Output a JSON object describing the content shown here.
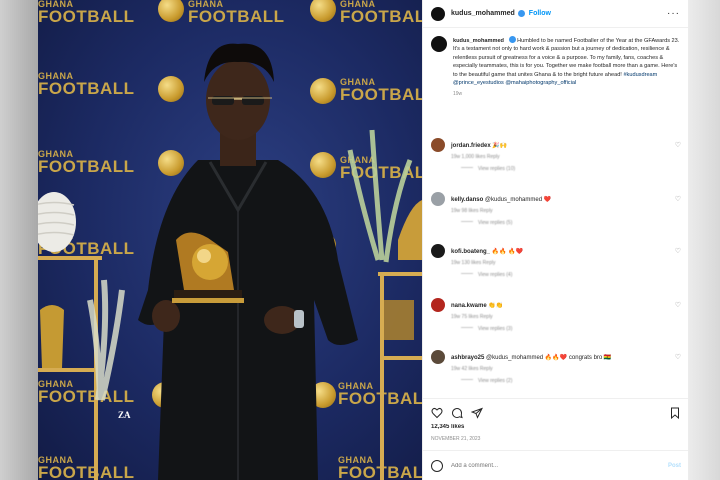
{
  "photo": {
    "logo_line1": "GHANA",
    "logo_line2": "FOOTBALL",
    "watermark": "ZA"
  },
  "post": {
    "username": "kudus_mohammed",
    "follow_label": "Follow",
    "more_label": "···",
    "caption": {
      "username": "kudus_mohammed",
      "text": "Humbled to be named Footballer of the Year at the GFAwards 23. It's a testament not only to hard work & passion but a journey of dedication, resilience & relentless pursuit of greatness for a voice & a purpose. To my family, fans, coaches & especially teammates, this is for you. Together we make football more than a game. Here's to the beautiful game that unites Ghana & to the bright future ahead!",
      "hashtag": "#kudusdream",
      "mentions": "@prince_eyestudios @mahaiphotography_official",
      "time": "19w"
    },
    "comments": [
      {
        "user": "jordan.friedex",
        "text": "🎉🙌",
        "meta": "19w  1,000 likes  Reply",
        "replies": "View replies (10)",
        "avatar_color": "#8a4b2a"
      },
      {
        "user": "kelly.danso",
        "text": "@kudus_mohammed ❤️",
        "meta": "19w  98 likes  Reply",
        "replies": "View replies (5)",
        "avatar_color": "#9aa0a6"
      },
      {
        "user": "kofi.boateng_",
        "text": "🔥🔥 🔥❤️",
        "meta": "19w  130 likes  Reply",
        "replies": "View replies (4)",
        "avatar_color": "#1a1a1a"
      },
      {
        "user": "nana.kwame",
        "text": "👏👏",
        "meta": "19w  75 likes  Reply",
        "replies": "View replies (3)",
        "avatar_color": "#b3261e"
      },
      {
        "user": "ashbrayo25",
        "text": "@kudus_mohammed 🔥🔥❤️ congrats bro 🇬🇭",
        "meta": "19w  42 likes  Reply",
        "replies": "View replies (2)",
        "avatar_color": "#5b4a3a"
      }
    ],
    "likes": "12,345 likes",
    "post_time": "NOVEMBER 21, 2023",
    "add_comment_placeholder": "Add a comment...",
    "post_button": "Post"
  },
  "icons": {
    "heart": "heart-icon",
    "comment": "comment-icon",
    "share": "share-icon",
    "save": "bookmark-icon",
    "verified": "verified-badge-icon",
    "emoji": "emoji-icon"
  },
  "colors": {
    "accent": "#0095f6",
    "verified": "#3897f0",
    "backdrop": "#1c2a63",
    "logo_gold": "#c9a64a"
  }
}
